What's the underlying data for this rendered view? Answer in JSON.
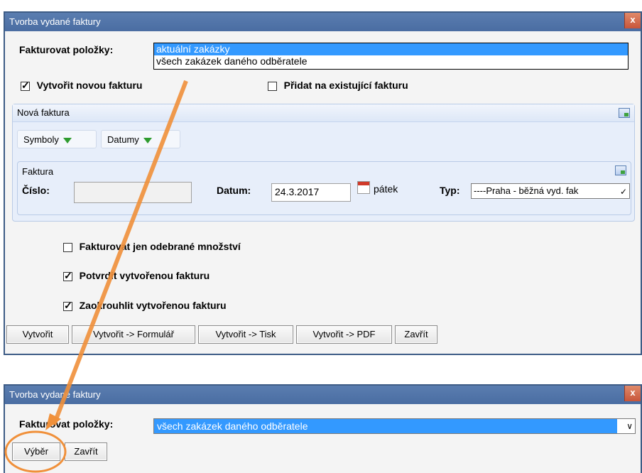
{
  "background": {
    "partial_text": "...ebrane......"
  },
  "top_dialog": {
    "title": "Tvorba vydané faktury",
    "close_label": "x",
    "fakturovat_label": "Fakturovat položky:",
    "listbox_options": [
      "aktuální zakázky",
      "všech zakázek daného odběratele"
    ],
    "listbox_selected": "aktuální zakázky",
    "create_new_label": "Vytvořit novou fakturu",
    "create_new_checked": true,
    "add_existing_label": "Přidat na existující fakturu",
    "add_existing_checked": false,
    "new_invoice_section": {
      "title": "Nová faktura",
      "tabs": [
        "Symboly",
        "Datumy"
      ],
      "invoice_subsection": {
        "title": "Faktura",
        "number_label": "Číslo:",
        "number_value": "",
        "date_label": "Datum:",
        "date_value": "24.3.2017",
        "weekday": "pátek",
        "type_label": "Typ:",
        "type_value": "----Praha - běžná vyd. fak"
      }
    },
    "options": [
      {
        "label": "Fakturovat jen odebrané množství",
        "checked": false
      },
      {
        "label": "Potvrdit vytvořenou fakturu",
        "checked": true
      },
      {
        "label": "Zaokrouhlit vytvořenou fakturu",
        "checked": true
      }
    ],
    "buttons": [
      "Vytvořit",
      "Vytvořit -> Formulář",
      "Vytvořit -> Tisk",
      "Vytvořit -> PDF",
      "Zavřít"
    ]
  },
  "bottom_dialog": {
    "title": "Tvorba vydané faktury",
    "close_label": "x",
    "fakturovat_label": "Fakturovat položky:",
    "select_value": "všech zakázek daného odběratele",
    "buttons": [
      "Výběr",
      "Zavřít"
    ]
  },
  "annotation": {
    "arrow_color": "#f0903a",
    "circle_color": "#f0903a"
  }
}
